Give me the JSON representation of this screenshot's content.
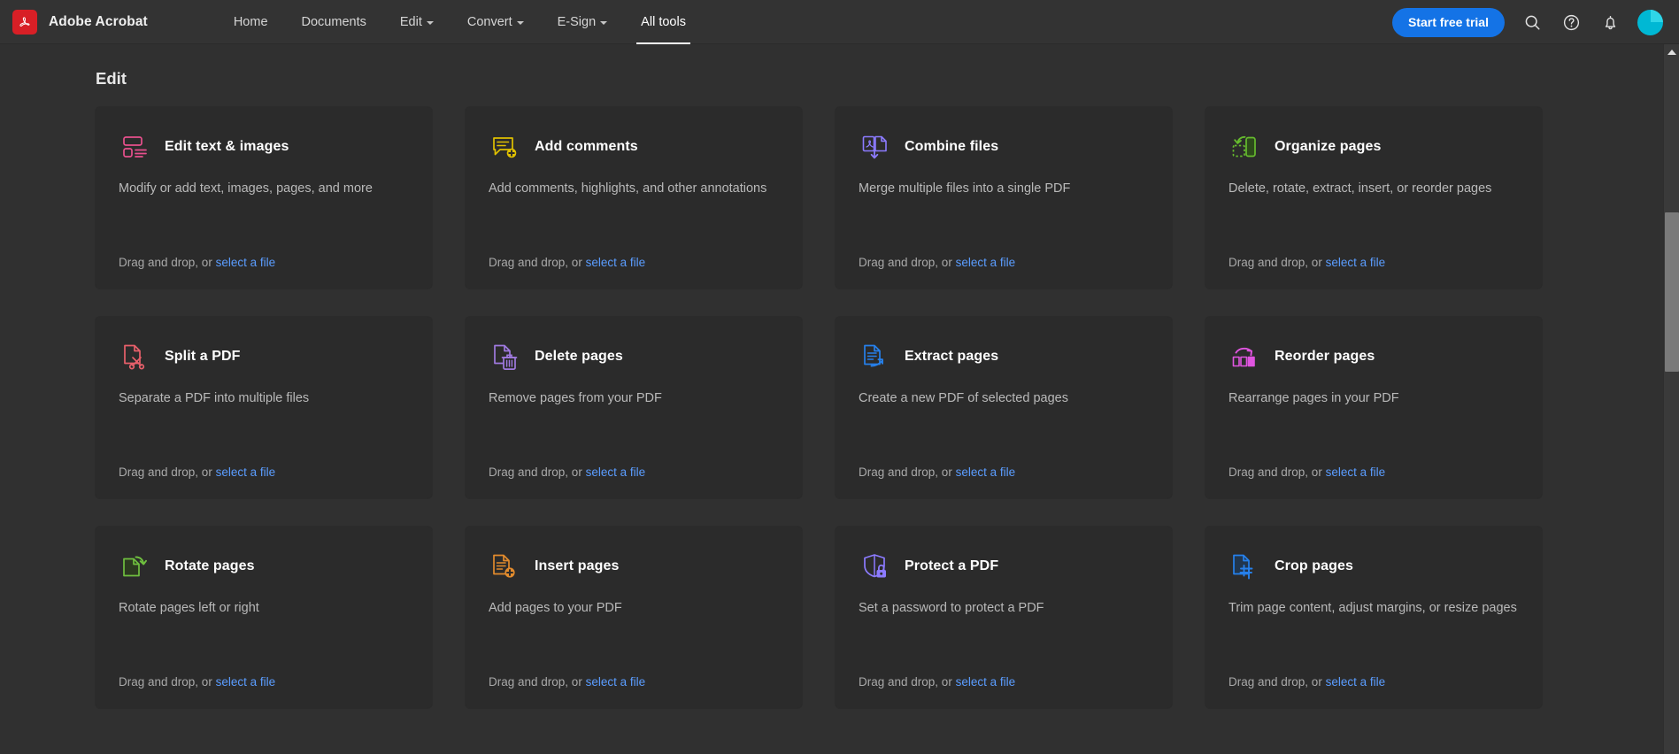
{
  "app": {
    "brand_name": "Adobe Acrobat",
    "logo_icon": "adobe-acrobat-logo"
  },
  "nav": {
    "tabs": [
      {
        "label": "Home",
        "has_caret": false,
        "active": false
      },
      {
        "label": "Documents",
        "has_caret": false,
        "active": false
      },
      {
        "label": "Edit",
        "has_caret": true,
        "active": false
      },
      {
        "label": "Convert",
        "has_caret": true,
        "active": false
      },
      {
        "label": "E-Sign",
        "has_caret": true,
        "active": false
      },
      {
        "label": "All tools",
        "has_caret": false,
        "active": true
      }
    ]
  },
  "topright": {
    "trial_label": "Start free trial",
    "search_icon": "search-icon",
    "help_icon": "help-circle-icon",
    "notifications_icon": "bell-icon",
    "avatar_icon": "user-avatar"
  },
  "main": {
    "title": "Edit",
    "drop_prefix": "Drag and drop, or ",
    "drop_link": "select a file",
    "cards": [
      {
        "title": "Edit text & images",
        "desc": "Modify or add text, images, pages, and more",
        "icon": "edit-text-images-icon",
        "color": "#e8508d"
      },
      {
        "title": "Add comments",
        "desc": "Add comments, highlights, and other annotations",
        "icon": "add-comments-icon",
        "color": "#e0c000"
      },
      {
        "title": "Combine files",
        "desc": "Merge multiple files into a single PDF",
        "icon": "combine-files-icon",
        "color": "#8c7bff"
      },
      {
        "title": "Organize pages",
        "desc": "Delete, rotate, extract, insert, or reorder pages",
        "icon": "organize-pages-icon",
        "color": "#66bb2e"
      },
      {
        "title": "Split a PDF",
        "desc": "Separate a PDF into multiple files",
        "icon": "split-pdf-icon",
        "color": "#e8606b"
      },
      {
        "title": "Delete pages",
        "desc": "Remove pages from your PDF",
        "icon": "delete-pages-icon",
        "color": "#a濃"
      },
      {
        "title": "Extract pages",
        "desc": "Create a new PDF of selected pages",
        "icon": "extract-pages-icon",
        "color": "#2680eb"
      },
      {
        "title": "Reorder pages",
        "desc": "Rearrange pages in your PDF",
        "icon": "reorder-pages-icon",
        "color": "#e055e0"
      },
      {
        "title": "Rotate pages",
        "desc": "Rotate pages left or right",
        "icon": "rotate-pages-icon",
        "color": "#6fbf3f"
      },
      {
        "title": "Insert pages",
        "desc": "Add pages to your PDF",
        "icon": "insert-pages-icon",
        "color": "#e28b2d"
      },
      {
        "title": "Protect a PDF",
        "desc": "Set a password to protect a PDF",
        "icon": "protect-pdf-icon",
        "color": "#8c7bff"
      },
      {
        "title": "Crop pages",
        "desc": "Trim page content, adjust margins, or resize pages",
        "icon": "crop-pages-icon",
        "color": "#2680eb"
      }
    ]
  },
  "scrollbar": {
    "up_arrow": "scroll-up-arrow",
    "down_arrow": "scroll-down-arrow"
  },
  "colors": {
    "accent_blue": "#1473e6",
    "link_blue": "#5b9dff",
    "bg": "#303030",
    "card_bg": "#2b2b2b",
    "topbar_bg": "#333333"
  }
}
